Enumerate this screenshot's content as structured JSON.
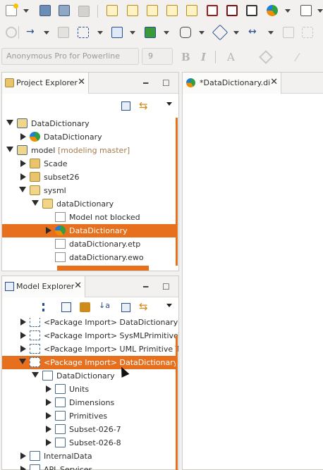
{
  "toolbar": {
    "font_placeholder": "Anonymous Pro for Powerline",
    "font_size": "9",
    "bold_label": "B",
    "italic_label": "I",
    "font_color_label": "A"
  },
  "project_explorer": {
    "title": "Project Explorer",
    "close": "✕",
    "minimize": "━",
    "maximize": "☐",
    "rows": [
      {
        "label": "DataDictionary",
        "suffix": "",
        "state": "open",
        "indent": 0,
        "icon": "project-folder",
        "selected": false
      },
      {
        "label": "DataDictionary",
        "suffix": "",
        "state": "closed",
        "indent": 1,
        "icon": "scade-model",
        "selected": false
      },
      {
        "label": "model",
        "suffix": "[modeling master]",
        "state": "open",
        "indent": 0,
        "icon": "project-folder",
        "selected": false
      },
      {
        "label": "Scade",
        "suffix": "",
        "state": "closed",
        "indent": 1,
        "icon": "folder",
        "selected": false
      },
      {
        "label": "subset26",
        "suffix": "",
        "state": "closed",
        "indent": 1,
        "icon": "folder",
        "selected": false
      },
      {
        "label": "sysml",
        "suffix": "",
        "state": "open",
        "indent": 1,
        "icon": "folder-open",
        "selected": false
      },
      {
        "label": "dataDictionary",
        "suffix": "",
        "state": "open",
        "indent": 2,
        "icon": "folder-open",
        "selected": false
      },
      {
        "label": "Model not blocked",
        "suffix": "",
        "state": "none",
        "indent": 3,
        "icon": "file-lock",
        "selected": false
      },
      {
        "label": "DataDictionary",
        "suffix": "",
        "state": "closed",
        "indent": 3,
        "icon": "scade-model",
        "selected": true
      },
      {
        "label": "dataDictionary.etp",
        "suffix": "",
        "state": "none",
        "indent": 3,
        "icon": "file",
        "selected": false
      },
      {
        "label": "dataDictionary.ewo",
        "suffix": "",
        "state": "none",
        "indent": 3,
        "icon": "file",
        "selected": false
      }
    ]
  },
  "editor": {
    "tab_label": "*DataDictionary.di",
    "close": "✕"
  },
  "model_explorer": {
    "title": "Model Explorer",
    "close": "✕",
    "minimize": "━",
    "maximize": "☐",
    "rows": [
      {
        "label": "<Package Import> DataDictionary",
        "state": "closed",
        "indent": 0,
        "icon": "package-import",
        "selected": false
      },
      {
        "label": "<Package Import> SysMLPrimitiveTypes",
        "state": "closed",
        "indent": 0,
        "icon": "package-import",
        "selected": false
      },
      {
        "label": "<Package Import> UML Primitive Types",
        "state": "closed",
        "indent": 0,
        "icon": "package-import",
        "selected": false
      },
      {
        "label": "<Package Import> DataDictionary",
        "state": "open",
        "indent": 0,
        "icon": "package-import",
        "selected": true
      },
      {
        "label": "DataDictionary",
        "state": "open",
        "indent": 1,
        "icon": "package",
        "selected": false
      },
      {
        "label": "Units",
        "state": "closed",
        "indent": 2,
        "icon": "package",
        "selected": false
      },
      {
        "label": "Dimensions",
        "state": "closed",
        "indent": 2,
        "icon": "package",
        "selected": false
      },
      {
        "label": "Primitives",
        "state": "closed",
        "indent": 2,
        "icon": "package",
        "selected": false
      },
      {
        "label": "Subset-026-7",
        "state": "closed",
        "indent": 2,
        "icon": "package",
        "selected": false
      },
      {
        "label": "Subset-026-8",
        "state": "closed",
        "indent": 2,
        "icon": "package",
        "selected": false
      },
      {
        "label": "InternalData",
        "state": "closed",
        "indent": 0,
        "icon": "package",
        "selected": false
      },
      {
        "label": "API_Services",
        "state": "closed",
        "indent": 0,
        "icon": "package",
        "selected": false
      }
    ]
  },
  "colors": {
    "selection": "#e7701f",
    "background": "#f2f1f0"
  }
}
